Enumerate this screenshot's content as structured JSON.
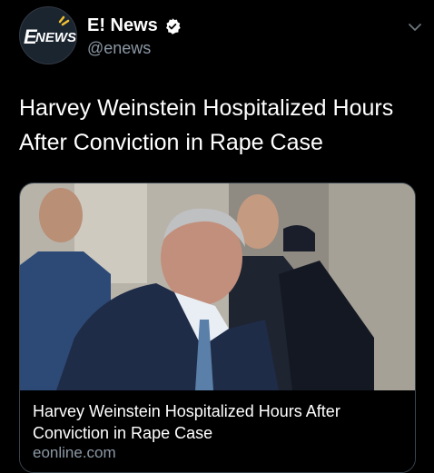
{
  "tweet": {
    "display_name": "E! News",
    "handle": "@enews",
    "verified": true,
    "avatar_logo": "NEWS",
    "text": "Harvey Weinstein Hospitalized Hours After Conviction in Rape Case"
  },
  "card": {
    "title": "Harvey Weinstein Hospitalized Hours After Conviction in Rape Case",
    "domain": "eonline.com",
    "image_icon": "news-photo"
  },
  "icons": {
    "verified": "verified-badge-icon",
    "more": "chevron-down-icon"
  },
  "colors": {
    "background": "#000000",
    "text": "#ffffff",
    "secondary_text": "#8b98a5",
    "card_border": "#38444d",
    "verified_badge": "#ffffff"
  }
}
